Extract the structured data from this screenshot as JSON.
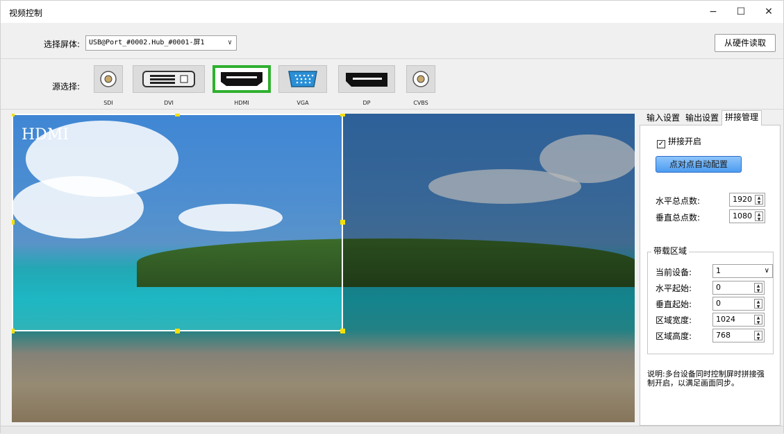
{
  "window": {
    "title": "视频控制",
    "minimize": "−",
    "maximize": "☐",
    "close": "✕"
  },
  "screen_selector": {
    "label": "选择屏体:",
    "value": "USB@Port_#0002.Hub_#0001-屏1",
    "read_button": "从硬件读取"
  },
  "sources": {
    "label": "源选择:",
    "items": [
      {
        "name": "SDI",
        "icon": "bnc-connector-icon"
      },
      {
        "name": "DVI",
        "icon": "dvi-port-icon"
      },
      {
        "name": "HDMI",
        "icon": "hdmi-port-icon",
        "selected": true
      },
      {
        "name": "VGA",
        "icon": "vga-port-icon"
      },
      {
        "name": "DP",
        "icon": "displayport-icon"
      },
      {
        "name": "CVBS",
        "icon": "bnc-connector-icon"
      }
    ],
    "selected_color": "#2fb02f"
  },
  "preview": {
    "label": "HDMI"
  },
  "tabs": [
    "输入设置",
    "输出设置",
    "拼接管理"
  ],
  "splice": {
    "enable_label": "拼接开启",
    "enabled": true,
    "auto_button": "点对点自动配置",
    "h_total_label": "水平总点数:",
    "h_total": "1920",
    "v_total_label": "垂直总点数:",
    "v_total": "1080",
    "group_title": "带载区域",
    "device_label": "当前设备:",
    "device_value": "1",
    "h_start_label": "水平起始:",
    "h_start": "0",
    "v_start_label": "垂直起始:",
    "v_start": "0",
    "width_label": "区域宽度:",
    "width": "1024",
    "height_label": "区域高度:",
    "height": "768",
    "note": "说明:多台设备同时控制屏时拼接强制开启，以满足画面同步。"
  }
}
